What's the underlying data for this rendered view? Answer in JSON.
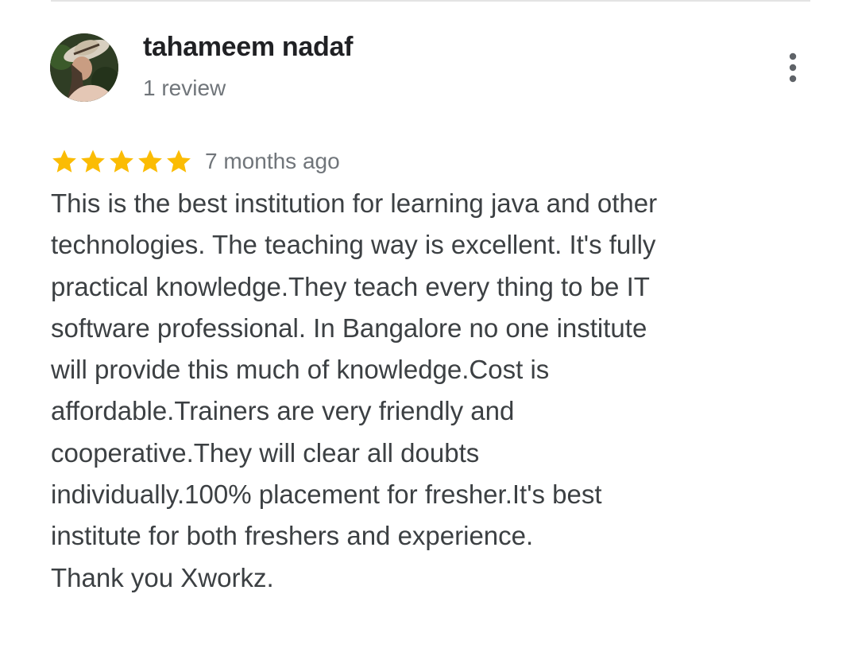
{
  "review": {
    "reviewer_name": "tahameem nadaf",
    "review_count": "1 review",
    "rating": 5,
    "rating_max": 5,
    "time_ago": "7 months ago",
    "text": "This is the best institution for learning java and other\ntechnologies. The teaching way is excellent. It's fully\npractical knowledge.They teach every thing to be IT\nsoftware professional. In Bangalore no one institute\nwill provide this much of knowledge.Cost is\naffordable.Trainers are very friendly and\ncooperative.They will clear all doubts\nindividually.100% placement for fresher.It's best\ninstitute for both freshers and experience.\nThank you Xworkz."
  },
  "icons": {
    "more": "more-vert-icon",
    "star": "star-icon"
  },
  "colors": {
    "star": "#fbbc04",
    "name": "#202124",
    "meta": "#70757a",
    "body": "#3c4043"
  }
}
